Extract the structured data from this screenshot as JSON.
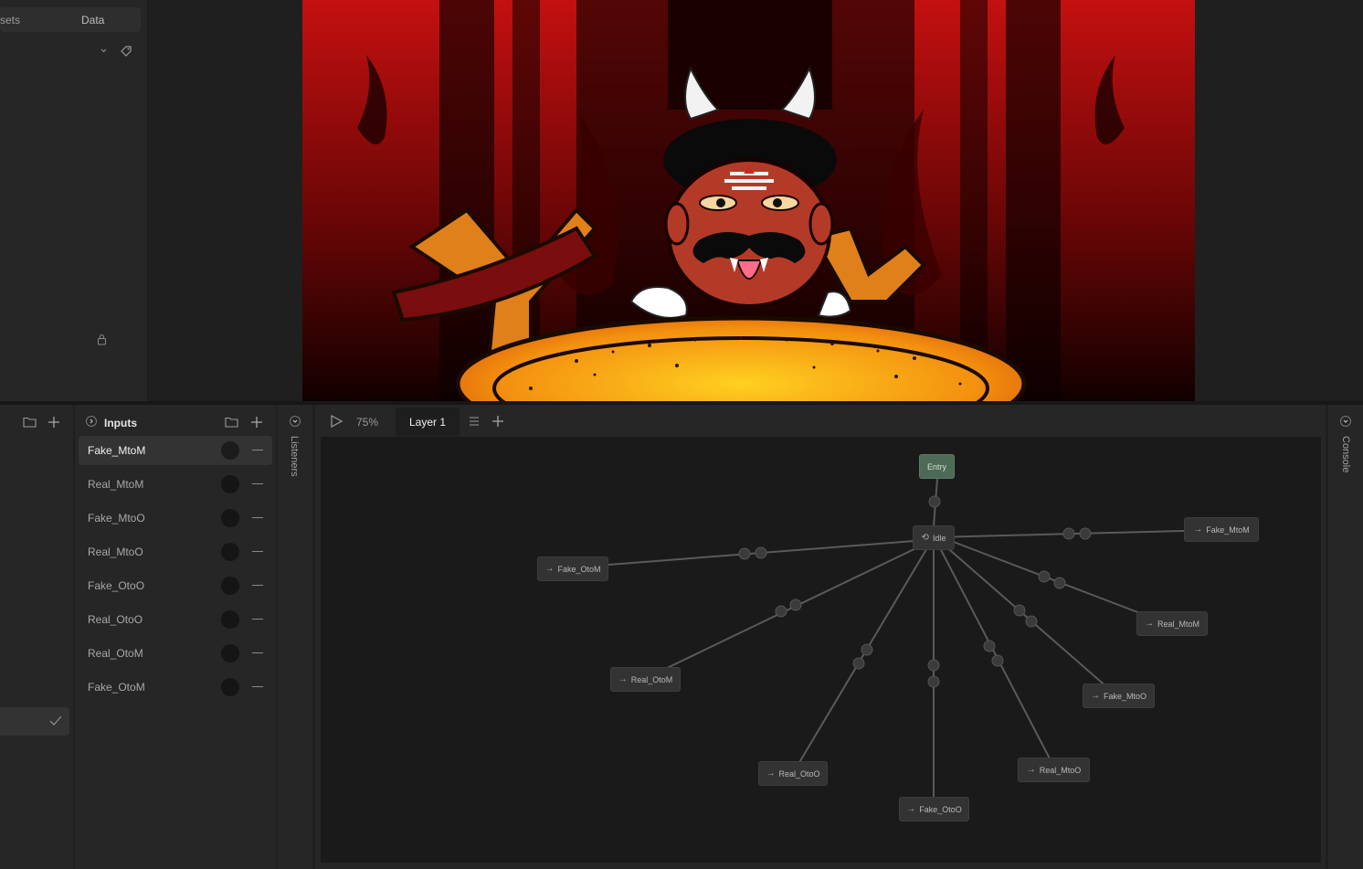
{
  "assets_panel": {
    "tab_assets": "sets",
    "tab_data": "Data"
  },
  "inputs_panel": {
    "title": "Inputs",
    "items": [
      {
        "label": "Fake_MtoM",
        "selected": true
      },
      {
        "label": "Real_MtoM",
        "selected": false
      },
      {
        "label": "Fake_MtoO",
        "selected": false
      },
      {
        "label": "Real_MtoO",
        "selected": false
      },
      {
        "label": "Fake_OtoO",
        "selected": false
      },
      {
        "label": "Real_OtoO",
        "selected": false
      },
      {
        "label": "Real_OtoM",
        "selected": false
      },
      {
        "label": "Fake_OtoM",
        "selected": false
      }
    ]
  },
  "listeners_panel": {
    "label": "Listeners"
  },
  "console_panel": {
    "label": "Console"
  },
  "graph_toolbar": {
    "zoom": "75%",
    "layer_tab": "Layer 1"
  },
  "state_graph": {
    "entry": "Entry",
    "idle": "Idle",
    "states": [
      "Fake_MtoM",
      "Fake_OtoM",
      "Real_MtoM",
      "Real_OtoM",
      "Fake_MtoO",
      "Real_OtoO",
      "Real_MtoO",
      "Fake_OtoO"
    ]
  },
  "colors": {
    "entry_node": "#4d6a56",
    "canvas_bg": "#1a1a1a",
    "panel_bg": "#262626"
  }
}
